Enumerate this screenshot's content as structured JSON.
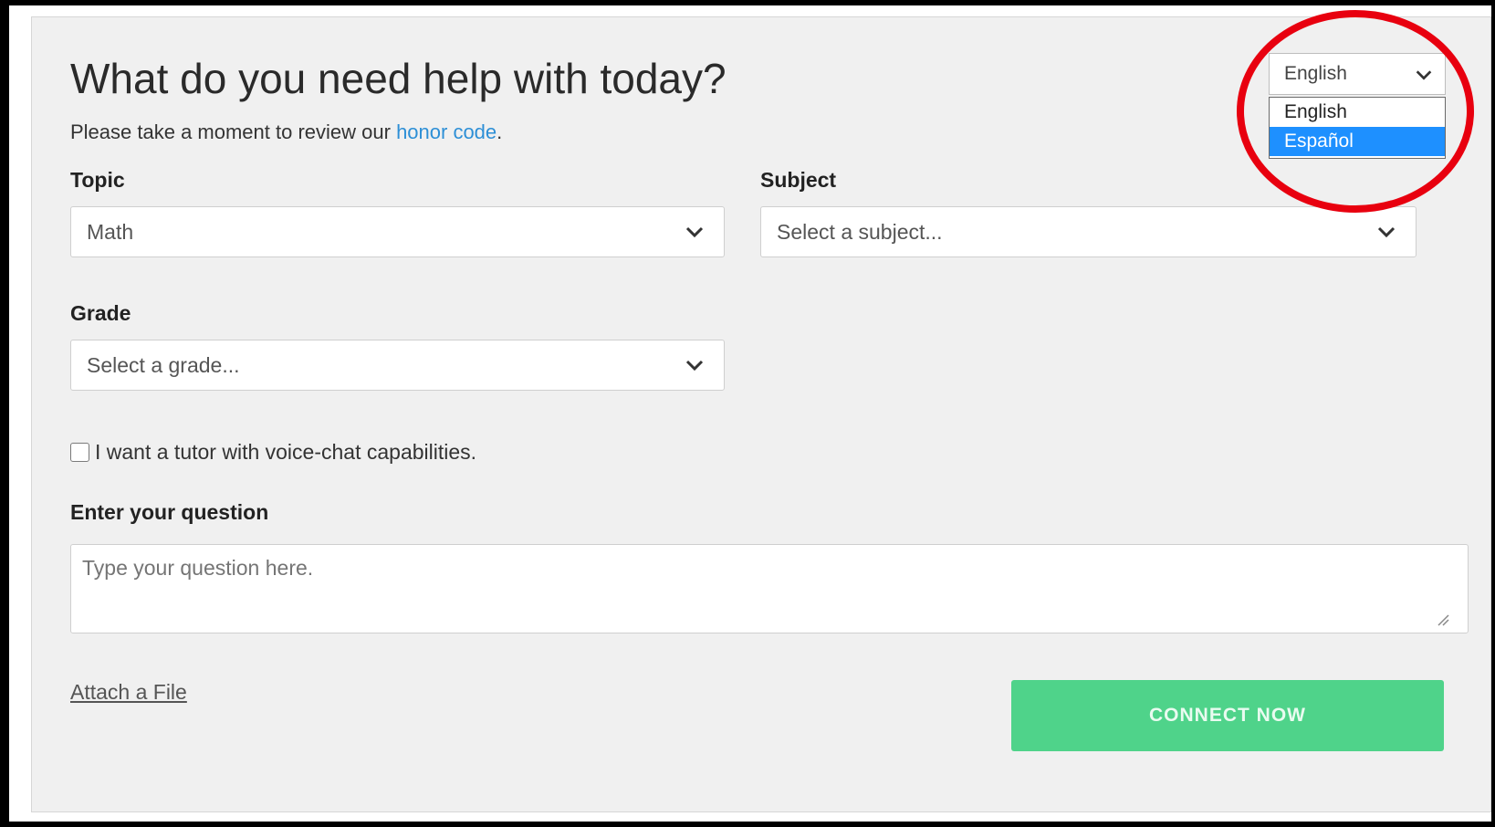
{
  "form": {
    "title": "What do you need help with today?",
    "subtitle_prefix": "Please take a moment to review our ",
    "honor_code_link": "honor code",
    "subtitle_suffix": ".",
    "topic": {
      "label": "Topic",
      "value": "Math"
    },
    "subject": {
      "label": "Subject",
      "value": "Select a subject..."
    },
    "grade": {
      "label": "Grade",
      "value": "Select a grade..."
    },
    "voice_chat": {
      "label": "I want a tutor with voice-chat capabilities.",
      "checked": false
    },
    "question": {
      "label": "Enter your question",
      "placeholder": "Type your question here.",
      "value": ""
    },
    "attach_label": "Attach a File",
    "connect_label": "CONNECT NOW"
  },
  "language": {
    "selected": "English",
    "options": [
      {
        "label": "English",
        "highlighted": false
      },
      {
        "label": "Español",
        "highlighted": true
      }
    ]
  },
  "colors": {
    "panel_bg": "#f0f0f0",
    "link": "#2d8fd6",
    "connect_button": "#4fd38a",
    "option_highlight": "#1e90ff",
    "annotation_ring": "#e8000f"
  }
}
